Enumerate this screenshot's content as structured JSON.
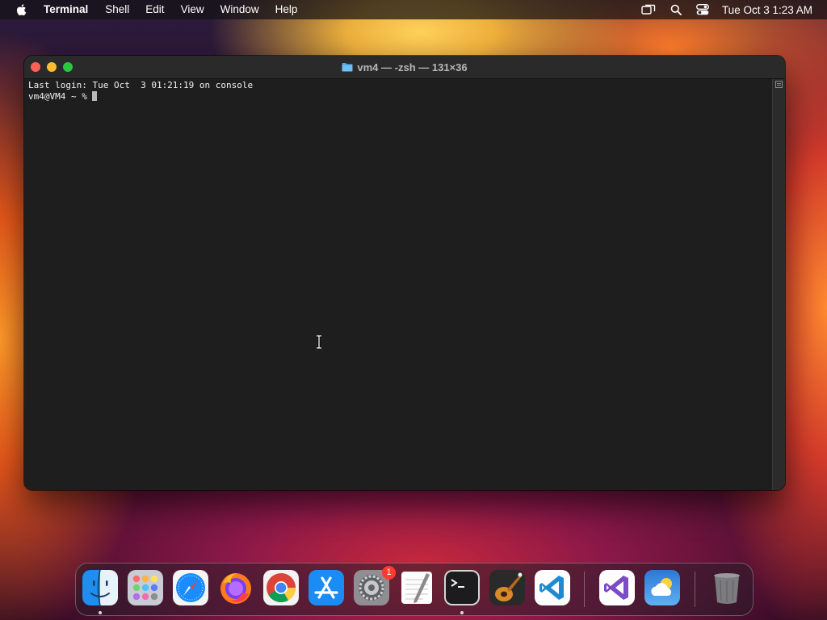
{
  "menubar": {
    "app_name": "Terminal",
    "menus": [
      "Shell",
      "Edit",
      "View",
      "Window",
      "Help"
    ],
    "clock": "Tue Oct 3  1:23 AM"
  },
  "window": {
    "title": "vm4 — -zsh — 131×36",
    "lines": [
      "Last login: Tue Oct  3 01:21:19 on console",
      "vm4@VM4 ~ % "
    ]
  },
  "dock": {
    "items": [
      {
        "name": "Finder",
        "running": true
      },
      {
        "name": "Launchpad",
        "running": false
      },
      {
        "name": "Safari",
        "running": false
      },
      {
        "name": "Firefox",
        "running": false
      },
      {
        "name": "Google Chrome",
        "running": false
      },
      {
        "name": "App Store",
        "running": false
      },
      {
        "name": "System Settings",
        "running": false,
        "badge": "1"
      },
      {
        "name": "TextEdit",
        "running": false
      },
      {
        "name": "Terminal",
        "running": true
      },
      {
        "name": "GarageBand",
        "running": false
      },
      {
        "name": "Visual Studio Code",
        "running": false
      },
      {
        "name": "Visual Studio",
        "running": false
      },
      {
        "name": "Weather",
        "running": false
      },
      {
        "name": "Trash",
        "running": false
      }
    ]
  },
  "colors": {
    "close": "#fe5f57",
    "minimize": "#febc2e",
    "maximize": "#28c840",
    "terminal_bg": "#1e1e1e",
    "badge": "#ff3b30"
  }
}
